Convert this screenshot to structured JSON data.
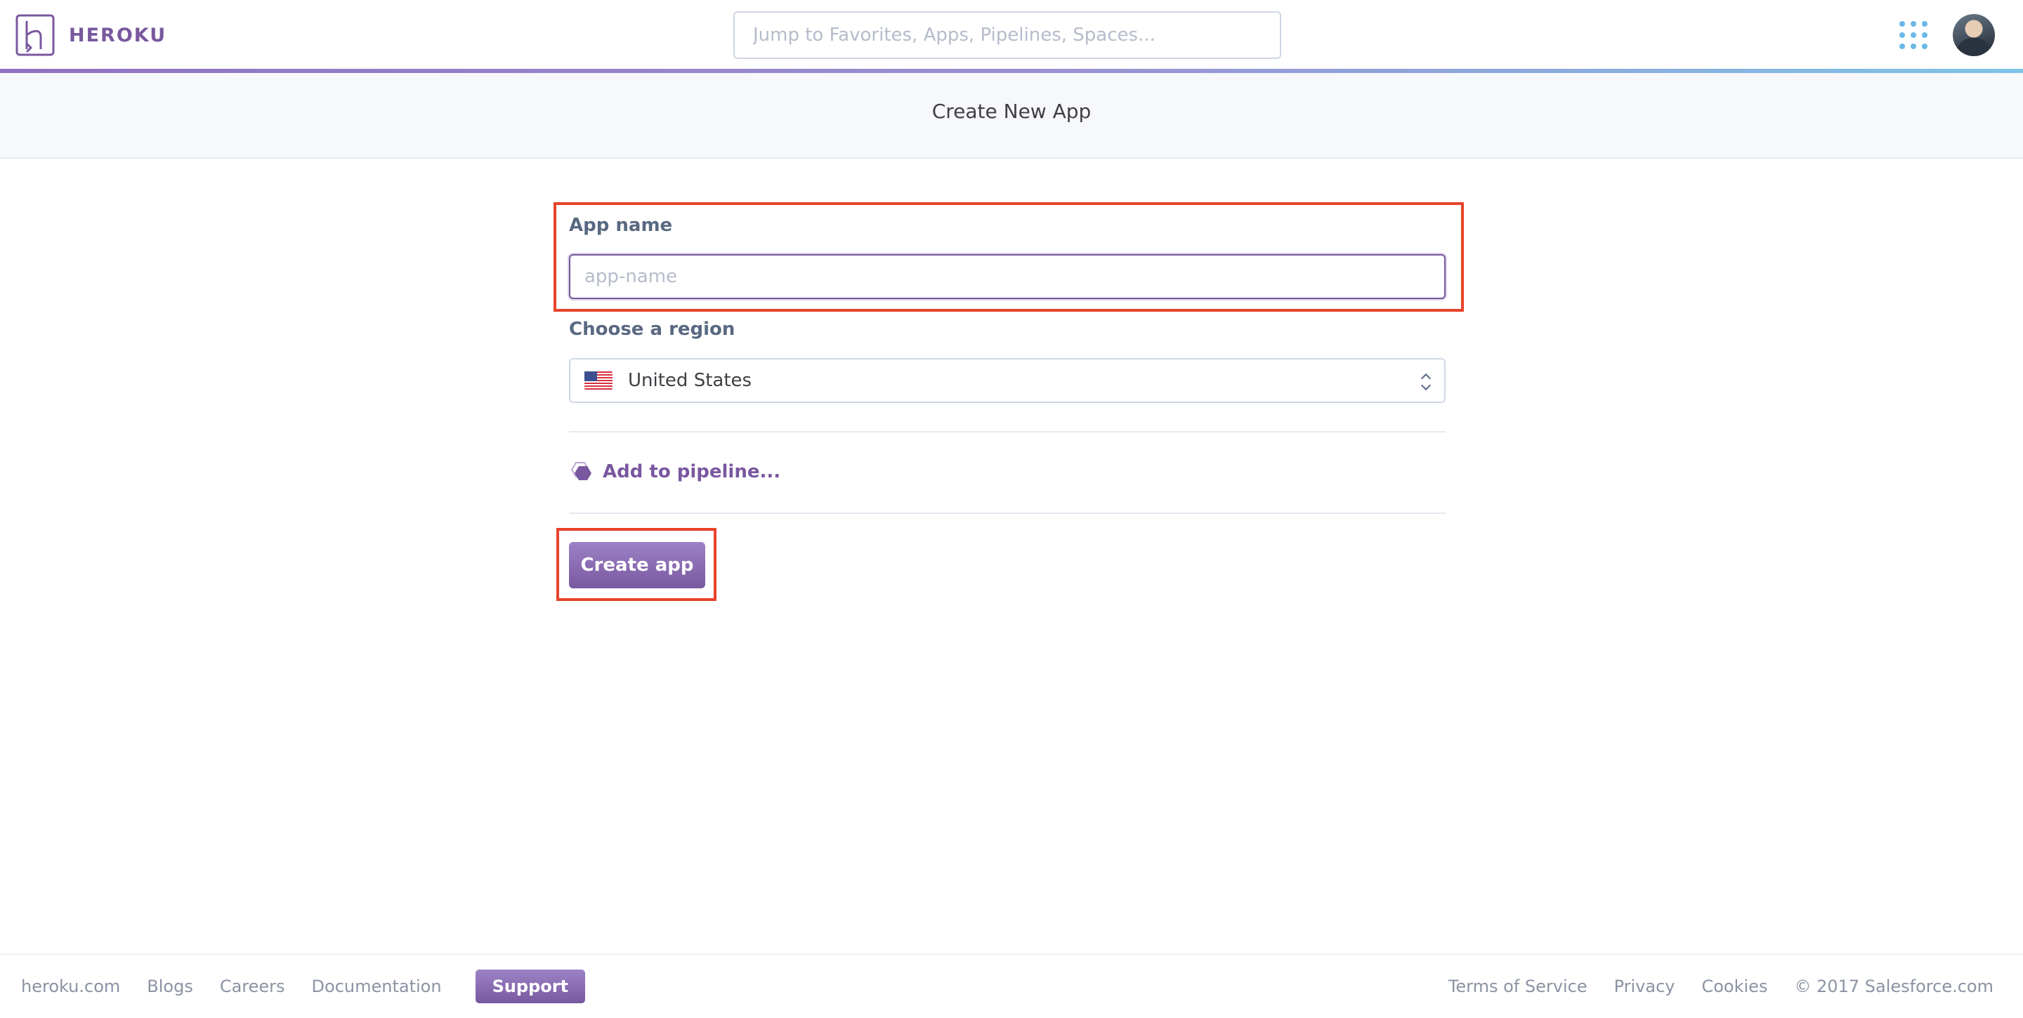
{
  "header": {
    "brand": "HEROKU",
    "search_placeholder": "Jump to Favorites, Apps, Pipelines, Spaces...",
    "icons": [
      "heroku-logo-icon",
      "apps-grid-icon",
      "avatar"
    ]
  },
  "subheader": {
    "title": "Create New App"
  },
  "form": {
    "app_name_label": "App name",
    "app_name_placeholder": "app-name",
    "app_name_value": "",
    "region_label": "Choose a region",
    "region_value": "United States",
    "pipeline_label": "Add to pipeline...",
    "create_label": "Create app"
  },
  "footer": {
    "left_links": [
      "heroku.com",
      "Blogs",
      "Careers",
      "Documentation"
    ],
    "support_label": "Support",
    "right_links": [
      "Terms of Service",
      "Privacy",
      "Cookies"
    ],
    "copyright": "© 2017 Salesforce.com"
  },
  "colors": {
    "brand": "#79589f",
    "annotation": "#e8432a",
    "accent_blue": "#6bb8e6"
  }
}
